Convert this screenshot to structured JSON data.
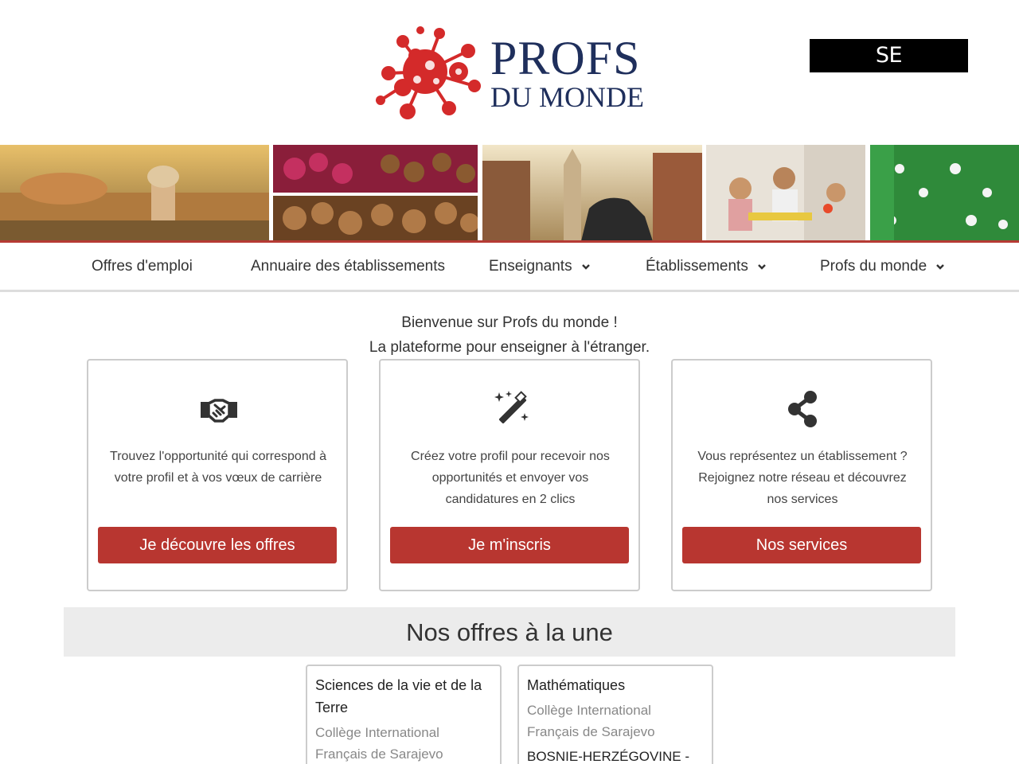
{
  "header": {
    "logo_title": "PROFS",
    "logo_subtitle": "DU MONDE",
    "login_label": "SE CONNECTER"
  },
  "nav": {
    "items": [
      {
        "label": "Offres d'emploi",
        "dropdown": false
      },
      {
        "label": "Annuaire des établissements",
        "dropdown": false
      },
      {
        "label": "Enseignants",
        "dropdown": true
      },
      {
        "label": "Établissements",
        "dropdown": true
      },
      {
        "label": "Profs du monde",
        "dropdown": true
      }
    ]
  },
  "welcome": {
    "line1": "Bienvenue sur Profs du monde !",
    "line2": "La plateforme pour enseigner à l'étranger."
  },
  "cards": [
    {
      "icon": "handshake-icon",
      "text": "Trouvez l'opportunité qui correspond à votre profil et à vos vœux de carrière",
      "button": "Je découvre les offres"
    },
    {
      "icon": "magic-wand-icon",
      "text": "Créez votre profil pour recevoir nos opportunités et envoyer vos candidatures en 2 clics",
      "button": "Je m'inscris"
    },
    {
      "icon": "share-icon",
      "text": "Vous représentez un établissement ? Rejoignez notre réseau et découvrez nos services",
      "button": "Nos services"
    }
  ],
  "featured": {
    "title": "Nos offres à la une",
    "jobs": [
      {
        "title": "Sciences de la vie et de la Terre",
        "school": "Collège International Français de Sarajevo",
        "country": ""
      },
      {
        "title": "Mathématiques",
        "school": "Collège International Français de Sarajevo",
        "country": "BOSNIE-HERZÉGOVINE -"
      }
    ]
  },
  "colors": {
    "accent": "#b83630",
    "brand_navy": "#1f2f5c",
    "logo_red": "#d42a2a"
  }
}
